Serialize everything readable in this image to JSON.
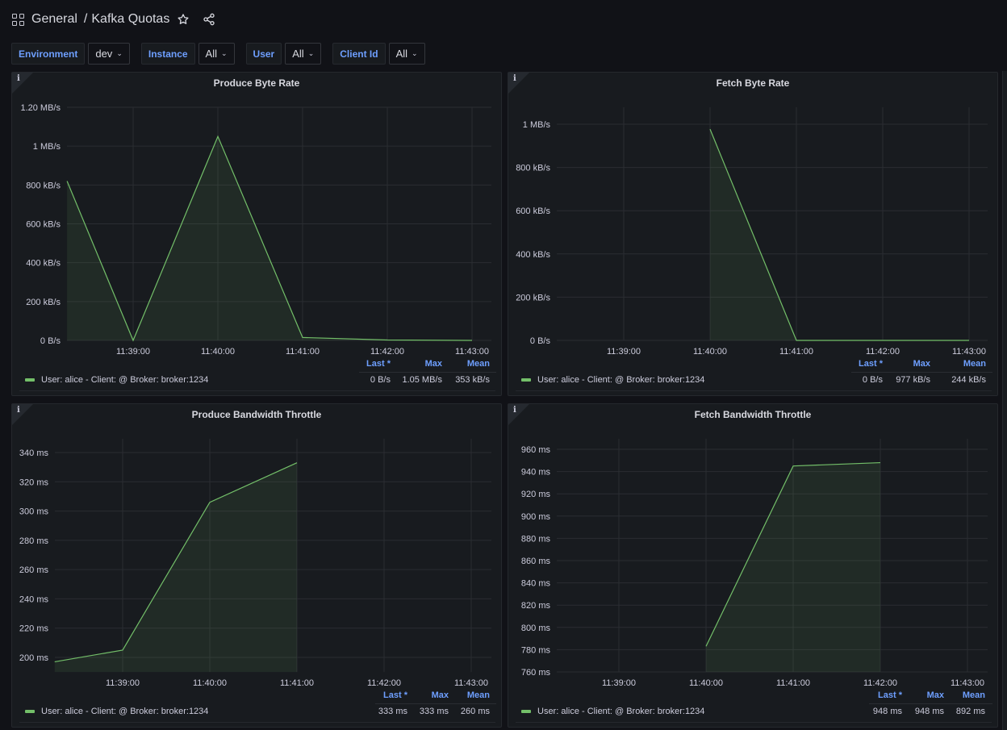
{
  "header": {
    "folder": "General",
    "separator": "/",
    "dashboard_title": "Kafka Quotas",
    "icons": [
      "grid-icon",
      "star-icon",
      "share-icon"
    ]
  },
  "variables": [
    {
      "label": "Environment",
      "value": "dev"
    },
    {
      "label": "Instance",
      "value": "All"
    },
    {
      "label": "User",
      "value": "All"
    },
    {
      "label": "Client Id",
      "value": "All"
    }
  ],
  "legend_headers": {
    "last": "Last *",
    "max": "Max",
    "mean": "Mean"
  },
  "series_color": "#73bf69",
  "chart_data": [
    {
      "type": "area",
      "title": "Produce Byte Rate",
      "unit": "bytes/s",
      "x_ticks": [
        "11:39:00",
        "11:40:00",
        "11:41:00",
        "11:42:00",
        "11:43:00"
      ],
      "x_range_minutes": [
        -0.8,
        4.23
      ],
      "y_ticks": [
        "0 B/s",
        "200 kB/s",
        "400 kB/s",
        "600 kB/s",
        "800 kB/s",
        "1 MB/s",
        "1.20 MB/s"
      ],
      "y_tick_values": [
        0,
        200,
        400,
        600,
        800,
        1000,
        1200
      ],
      "ylim": [
        0,
        1200
      ],
      "y_units": "kB/s",
      "grid": true,
      "series": [
        {
          "name": "User: alice - Client: @ Broker: broker:1234",
          "x_minutes": [
            -0.78,
            0,
            1,
            2,
            3,
            4
          ],
          "values": [
            820,
            0,
            1050,
            15,
            2,
            0
          ],
          "last": "0 B/s",
          "max": "1.05 MB/s",
          "mean": "353 kB/s"
        }
      ]
    },
    {
      "type": "area",
      "title": "Fetch Byte Rate",
      "unit": "bytes/s",
      "x_ticks": [
        "11:39:00",
        "11:40:00",
        "11:41:00",
        "11:42:00",
        "11:43:00"
      ],
      "x_range_minutes": [
        -1.28,
        4.22
      ],
      "y_ticks": [
        "0 B/s",
        "200 kB/s",
        "400 kB/s",
        "600 kB/s",
        "800 kB/s",
        "1 MB/s"
      ],
      "y_tick_values": [
        0,
        200,
        400,
        600,
        800,
        1000
      ],
      "ylim": [
        0,
        1000
      ],
      "y_units": "kB/s",
      "grid": true,
      "series": [
        {
          "name": "User: alice - Client: @ Broker: broker:1234",
          "x_minutes": [
            1,
            2,
            3,
            4
          ],
          "values": [
            977,
            0,
            0,
            0
          ],
          "last": "0 B/s",
          "max": "977 kB/s",
          "mean": "244 kB/s"
        }
      ]
    },
    {
      "type": "area",
      "title": "Produce Bandwidth Throttle",
      "unit": "ms",
      "x_ticks": [
        "11:39:00",
        "11:40:00",
        "11:41:00",
        "11:42:00",
        "11:43:00"
      ],
      "x_range_minutes": [
        -0.78,
        4.22
      ],
      "y_ticks": [
        "200 ms",
        "220 ms",
        "240 ms",
        "260 ms",
        "280 ms",
        "300 ms",
        "320 ms",
        "340 ms"
      ],
      "y_tick_values": [
        200,
        220,
        240,
        260,
        280,
        300,
        320,
        340
      ],
      "ylim": [
        190,
        350
      ],
      "grid": true,
      "series": [
        {
          "name": "User: alice - Client: @ Broker: broker:1234",
          "x_minutes": [
            -0.78,
            0,
            1,
            2
          ],
          "values": [
            197,
            205,
            306,
            333
          ],
          "last": "333 ms",
          "max": "333 ms",
          "mean": "260 ms"
        }
      ]
    },
    {
      "type": "area",
      "title": "Fetch Bandwidth Throttle",
      "unit": "ms",
      "x_ticks": [
        "11:39:00",
        "11:40:00",
        "11:41:00",
        "11:42:00",
        "11:43:00"
      ],
      "x_range_minutes": [
        -1.25,
        4.24
      ],
      "y_ticks": [
        "760 ms",
        "780 ms",
        "800 ms",
        "820 ms",
        "840 ms",
        "860 ms",
        "880 ms",
        "900 ms",
        "920 ms",
        "940 ms",
        "960 ms"
      ],
      "y_tick_values": [
        760,
        780,
        800,
        820,
        840,
        860,
        880,
        900,
        920,
        940,
        960
      ],
      "ylim": [
        760,
        970
      ],
      "grid": true,
      "series": [
        {
          "name": "User: alice - Client: @ Broker: broker:1234",
          "x_minutes": [
            1,
            2,
            3
          ],
          "values": [
            783,
            945,
            948
          ],
          "last": "948 ms",
          "max": "948 ms",
          "mean": "892 ms"
        }
      ]
    }
  ]
}
